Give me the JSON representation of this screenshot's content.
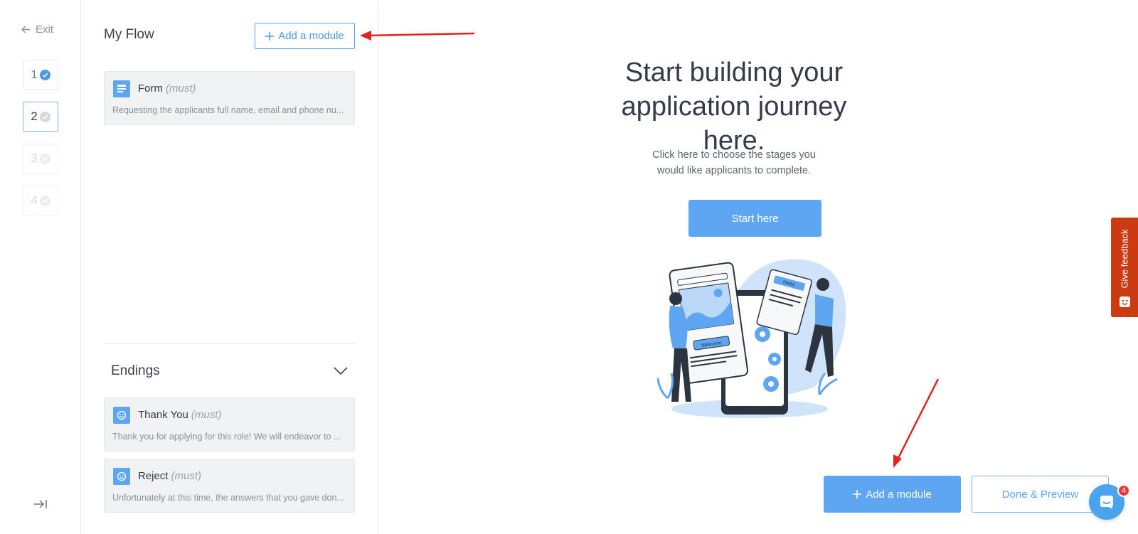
{
  "rail": {
    "exit_label": "Exit",
    "steps": [
      {
        "number": "1",
        "state": "complete"
      },
      {
        "number": "2",
        "state": "current"
      },
      {
        "number": "3",
        "state": "disabled"
      },
      {
        "number": "4",
        "state": "disabled"
      }
    ]
  },
  "flow": {
    "title": "My Flow",
    "add_module_label": "Add a module",
    "modules": [
      {
        "name": "Form",
        "tag": "(must)",
        "description": "Requesting the applicants full name, email and phone nu...",
        "icon": "form-icon"
      }
    ],
    "endings_title": "Endings",
    "endings": [
      {
        "name": "Thank You",
        "tag": "(must)",
        "description": "Thank you for applying for this role! We will endeavor to ...",
        "icon": "smile-icon"
      },
      {
        "name": "Reject",
        "tag": "(must)",
        "description": "Unfortunately at this time, the answers that you gave don...",
        "icon": "sad-icon"
      }
    ]
  },
  "main": {
    "headline": "Start building your application journey here.",
    "subtext": "Click here to choose the stages you would like applicants to complete.",
    "start_label": "Start here",
    "illustration_welcome": "Welcome",
    "illustration_hello": "Hello!",
    "add_module_label": "Add a module",
    "done_label": "Done & Preview"
  },
  "feedback": {
    "label": "Give feedback"
  },
  "chat": {
    "badge": "4"
  },
  "colors": {
    "accent": "#5ea6f2",
    "feedback": "#cc3a12",
    "arrow": "#e32222"
  }
}
